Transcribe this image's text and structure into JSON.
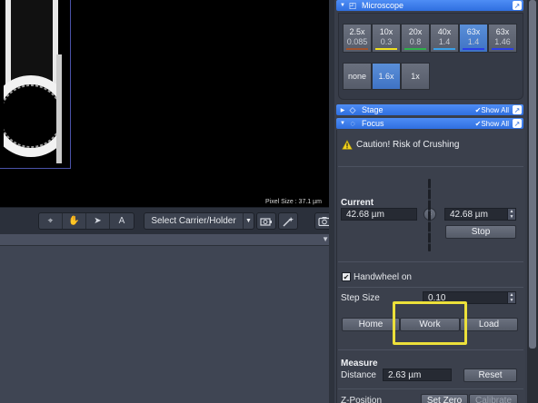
{
  "viewer": {
    "pixel_size": "Pixel Size : 37.1 µm"
  },
  "toolbar": {
    "tools": [
      {
        "icon": "crosshair-icon",
        "glyph": "⌖"
      },
      {
        "icon": "hand-icon",
        "glyph": "✋"
      },
      {
        "icon": "pointer-icon",
        "glyph": "➤"
      },
      {
        "icon": "text-icon",
        "glyph": "A"
      }
    ],
    "carrier_select": "Select Carrier/Holder",
    "camera_buttons": [
      "live-camera-icon",
      "magic-wand-icon",
      "snap-camera-icon"
    ]
  },
  "microscope": {
    "title": "Microscope",
    "objectives": [
      {
        "mag": "2.5x",
        "na": "0.085",
        "color": "#a0522d"
      },
      {
        "mag": "10x",
        "na": "0.3",
        "color": "#f0e020"
      },
      {
        "mag": "20x",
        "na": "0.8",
        "color": "#2fb14a"
      },
      {
        "mag": "40x",
        "na": "1.4",
        "color": "#3aa0e8"
      },
      {
        "mag": "63x",
        "na": "1.4",
        "color": "#2a3ee8"
      },
      {
        "mag": "63x",
        "na": "1.46",
        "color": "#2a3ee8"
      }
    ],
    "selected_objective": 4,
    "optovar": [
      "none",
      "1.6x",
      "1x"
    ],
    "selected_optovar": 1
  },
  "stage": {
    "title": "Stage",
    "show_all": "Show All"
  },
  "focus": {
    "title": "Focus",
    "show_all": "Show All",
    "caution": "Caution! Risk of Crushing",
    "current_label": "Current",
    "current_value": "42.68 µm",
    "target_value": "42.68 µm",
    "stop": "Stop",
    "handwheel": "Handwheel on",
    "step_size_label": "Step Size",
    "step_size_value": "0.10",
    "home": "Home",
    "work": "Work",
    "load": "Load",
    "measure_label": "Measure",
    "distance_label": "Distance",
    "distance_value": "2.63 µm",
    "reset": "Reset",
    "zpos_label": "Z-Position",
    "set_zero": "Set Zero",
    "calibrate": "Calibrate"
  }
}
